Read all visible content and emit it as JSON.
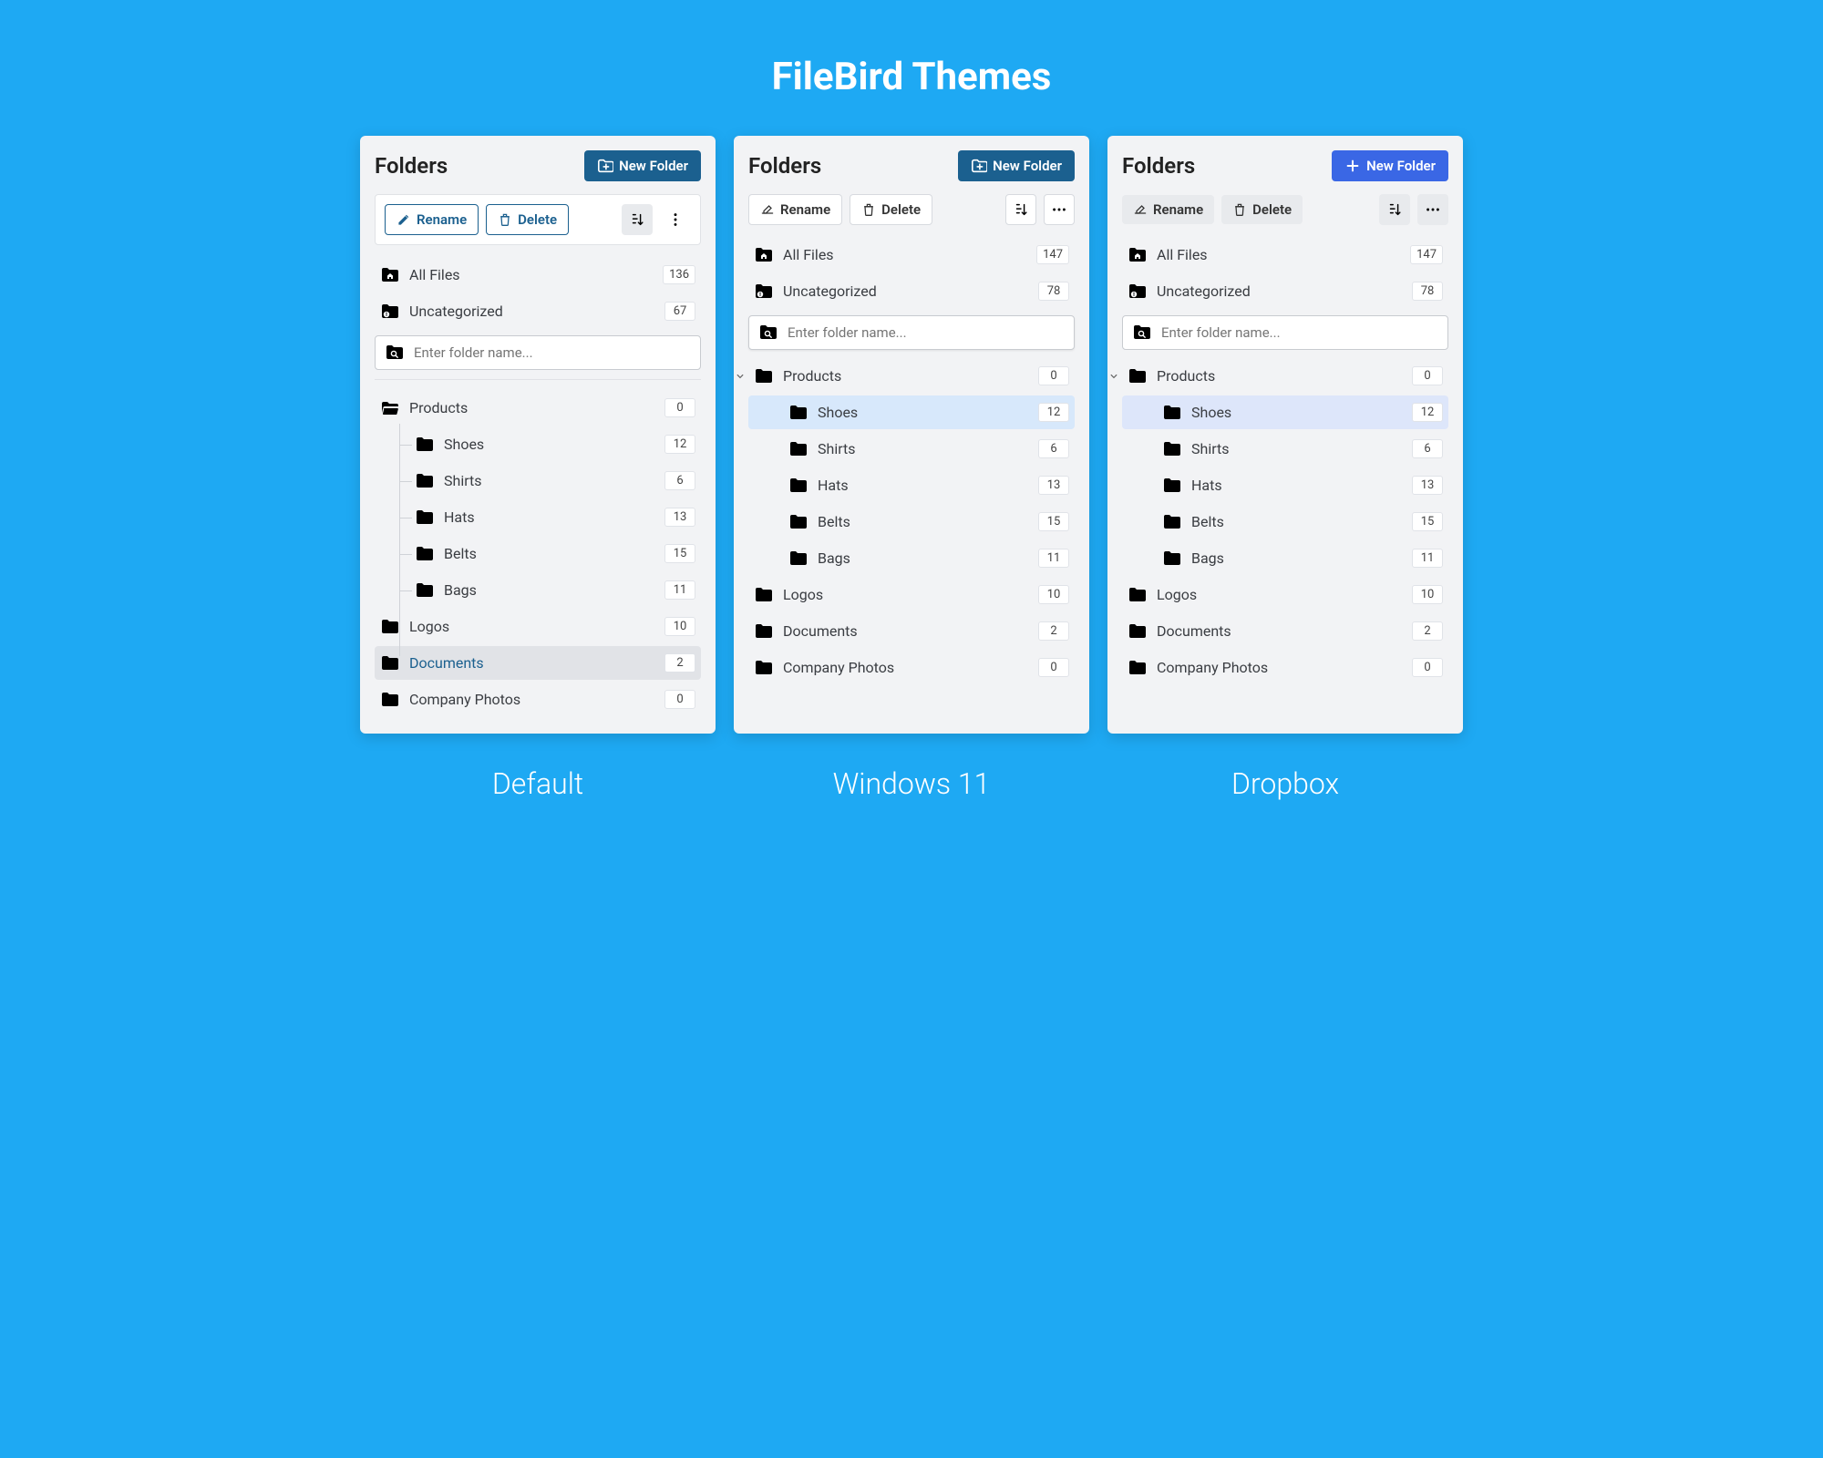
{
  "page_title": "FileBird Themes",
  "labels": {
    "folders": "Folders",
    "new_folder": "New Folder",
    "rename": "Rename",
    "delete": "Delete",
    "search_placeholder": "Enter folder name..."
  },
  "captions": {
    "default": "Default",
    "win": "Windows 11",
    "drop": "Dropbox"
  },
  "panel_default": {
    "all_files": {
      "label": "All Files",
      "count": "136"
    },
    "uncategorized": {
      "label": "Uncategorized",
      "count": "67"
    },
    "folders": [
      {
        "label": "Products",
        "count": "0",
        "expanded": true,
        "children": [
          {
            "label": "Shoes",
            "count": "12"
          },
          {
            "label": "Shirts",
            "count": "6"
          },
          {
            "label": "Hats",
            "count": "13"
          },
          {
            "label": "Belts",
            "count": "15"
          },
          {
            "label": "Bags",
            "count": "11"
          }
        ]
      },
      {
        "label": "Logos",
        "count": "10"
      },
      {
        "label": "Documents",
        "count": "2",
        "selected": true
      },
      {
        "label": "Company Photos",
        "count": "0"
      }
    ]
  },
  "panel_win": {
    "all_files": {
      "label": "All Files",
      "count": "147"
    },
    "uncategorized": {
      "label": "Uncategorized",
      "count": "78"
    },
    "folders": [
      {
        "label": "Products",
        "count": "0",
        "expanded": true,
        "children": [
          {
            "label": "Shoes",
            "count": "12",
            "selected": true
          },
          {
            "label": "Shirts",
            "count": "6"
          },
          {
            "label": "Hats",
            "count": "13"
          },
          {
            "label": "Belts",
            "count": "15"
          },
          {
            "label": "Bags",
            "count": "11"
          }
        ]
      },
      {
        "label": "Logos",
        "count": "10"
      },
      {
        "label": "Documents",
        "count": "2"
      },
      {
        "label": "Company Photos",
        "count": "0"
      }
    ]
  },
  "panel_drop": {
    "all_files": {
      "label": "All Files",
      "count": "147"
    },
    "uncategorized": {
      "label": "Uncategorized",
      "count": "78"
    },
    "folders": [
      {
        "label": "Products",
        "count": "0",
        "expanded": true,
        "children": [
          {
            "label": "Shoes",
            "count": "12",
            "selected": true
          },
          {
            "label": "Shirts",
            "count": "6"
          },
          {
            "label": "Hats",
            "count": "13"
          },
          {
            "label": "Belts",
            "count": "15"
          },
          {
            "label": "Bags",
            "count": "11"
          }
        ]
      },
      {
        "label": "Logos",
        "count": "10"
      },
      {
        "label": "Documents",
        "count": "2"
      },
      {
        "label": "Company Photos",
        "count": "0"
      }
    ]
  }
}
